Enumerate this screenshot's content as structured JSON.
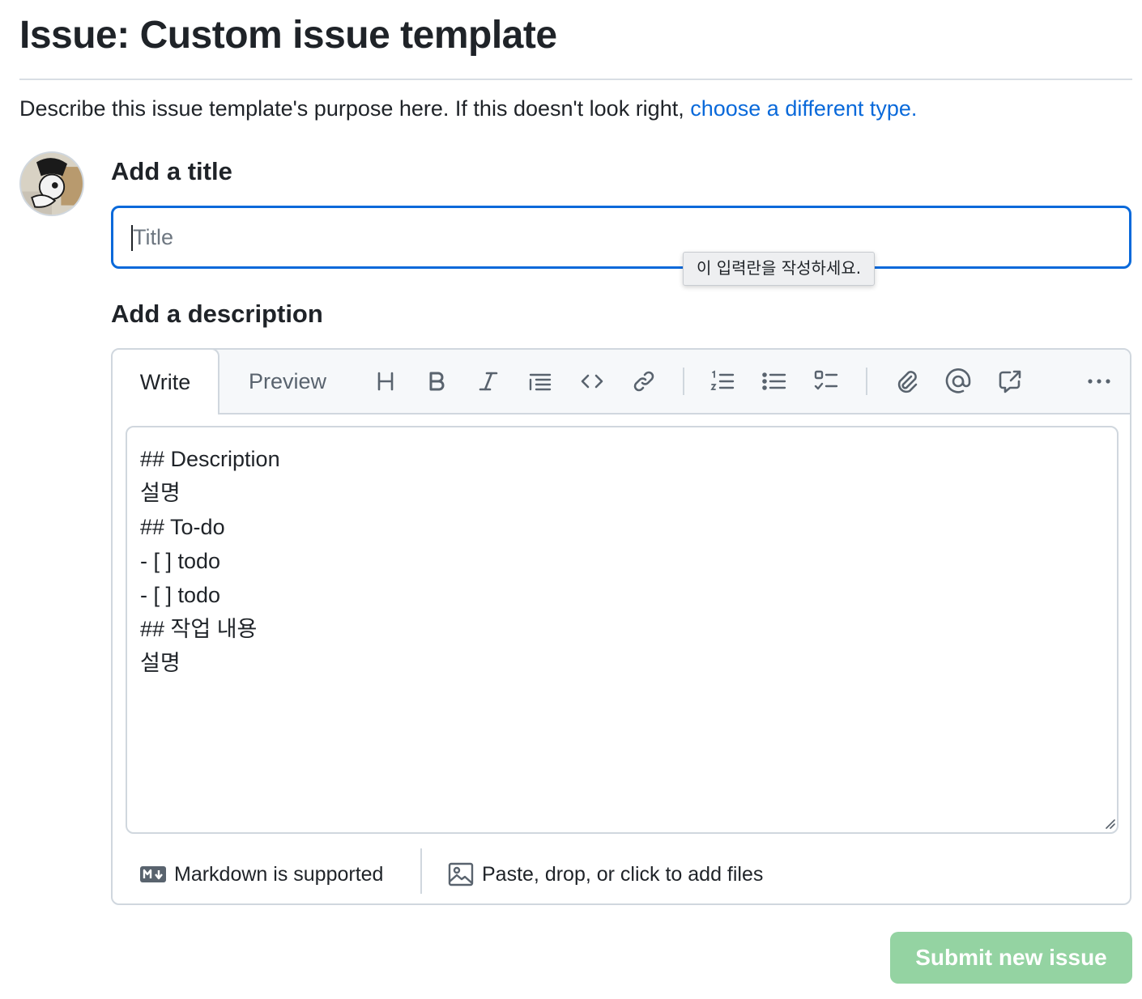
{
  "header": {
    "title": "Issue: Custom issue template",
    "description_prefix": "Describe this issue template's purpose here. If this doesn't look right, ",
    "description_link": "choose a different type."
  },
  "title_section": {
    "label": "Add a title",
    "placeholder": "Title",
    "value": "",
    "validation_tooltip": "이 입력란을 작성하세요."
  },
  "description_section": {
    "label": "Add a description",
    "tabs": [
      {
        "label": "Write",
        "active": true
      },
      {
        "label": "Preview",
        "active": false
      }
    ],
    "toolbar": [
      "heading-icon",
      "bold-icon",
      "italic-icon",
      "quote-icon",
      "code-icon",
      "link-icon",
      "numbered-list-icon",
      "bullet-list-icon",
      "task-list-icon",
      "attach-icon",
      "mention-icon",
      "reference-icon",
      "more-icon"
    ],
    "body": "## Description\n설명\n## To-do\n- [ ] todo\n- [ ] todo\n## 작업 내용\n설명",
    "footer": {
      "markdown": "Markdown is supported",
      "files": "Paste, drop, or click to add files"
    }
  },
  "actions": {
    "submit": "Submit new issue",
    "submit_color": "#94d3a2"
  },
  "colors": {
    "accent": "#0969da",
    "text": "#1f2328",
    "border": "#d0d7de"
  }
}
